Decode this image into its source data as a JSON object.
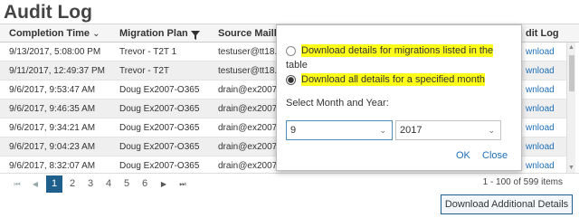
{
  "page_title": "Audit Log",
  "columns": {
    "completion_time": "Completion Time",
    "sort_indicator": "⌄",
    "migration_plan": "Migration Plan",
    "source_mailbox": "Source Mailb",
    "audit_log": "dit Log"
  },
  "rows": [
    {
      "time": "9/13/2017, 5:08:00 PM",
      "plan": "Trevor - T2T 1",
      "source": "testuser@tt18.",
      "link": "wnload"
    },
    {
      "time": "9/11/2017, 12:49:37 PM",
      "plan": "Trevor - T2T",
      "source": "testuser@tt18.",
      "link": "wnload"
    },
    {
      "time": "9/6/2017, 9:53:47 AM",
      "plan": "Doug Ex2007-O365",
      "source": "drain@ex2007.",
      "link": "wnload"
    },
    {
      "time": "9/6/2017, 9:46:35 AM",
      "plan": "Doug Ex2007-O365",
      "source": "drain@ex2007.",
      "link": "wnload"
    },
    {
      "time": "9/6/2017, 9:34:21 AM",
      "plan": "Doug Ex2007-O365",
      "source": "drain@ex2007.",
      "link": "wnload"
    },
    {
      "time": "9/6/2017, 9:04:23 AM",
      "plan": "Doug Ex2007-O365",
      "source": "drain@ex2007.",
      "link": "wnload"
    },
    {
      "time": "9/6/2017, 8:32:07 AM",
      "plan": "Doug Ex2007-O365",
      "source": "drain@ex2007.",
      "link": "wnload"
    }
  ],
  "pager": {
    "first": "⏮",
    "prev": "◀",
    "next": "▶",
    "last": "⏭",
    "pages": [
      "1",
      "2",
      "3",
      "4",
      "5",
      "6"
    ],
    "active_page": "1",
    "info": "1 - 100 of 599 items"
  },
  "download_additional_label": "Download Additional Details",
  "modal": {
    "option1_line1": "Download details for migrations listed in the",
    "option1_line2": "table",
    "option2": "Download all details for a specified month",
    "select_label": "Select Month and Year:",
    "month_value": "9",
    "year_value": "2017",
    "ok_label": "OK",
    "close_label": "Close"
  },
  "colors": {
    "accent": "#1f5f8c",
    "highlight": "#ffff1a",
    "link": "#1e6fb8"
  },
  "icons": {
    "filter": "filter-icon",
    "chevron": "chevron-down-icon"
  }
}
